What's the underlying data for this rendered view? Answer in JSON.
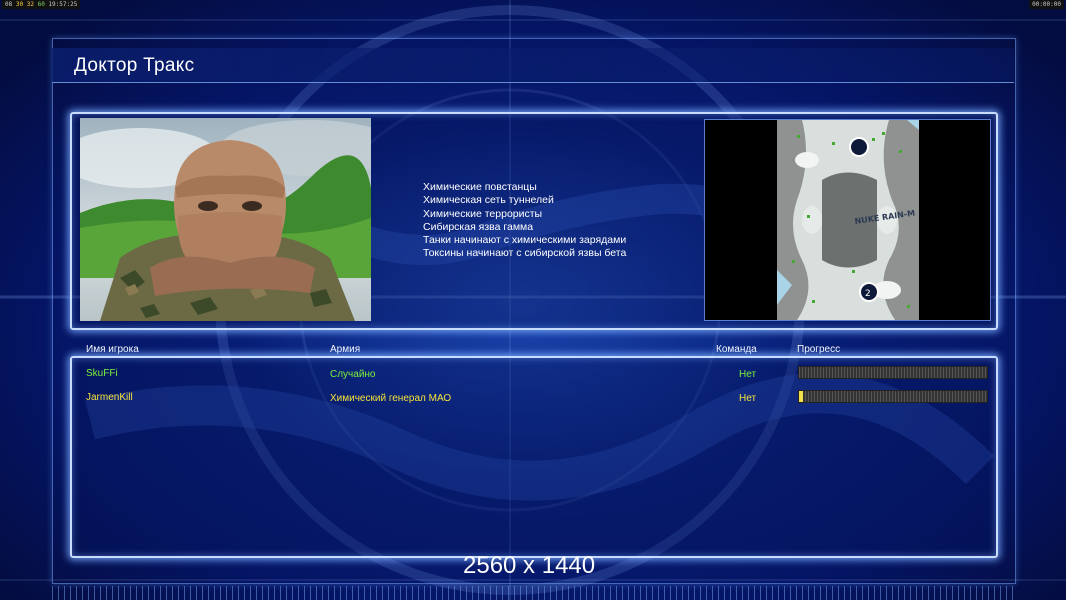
{
  "hud": {
    "left": [
      "08",
      "30",
      "32",
      "60",
      "19:57:25"
    ],
    "right": "00:00:00"
  },
  "general": {
    "name": "Доктор Тракс"
  },
  "info_lines": [
    "Химические повстанцы",
    "Химическая сеть туннелей",
    "Химические террористы",
    "Сибирская язва гамма",
    "Танки начинают с химическими зарядами",
    "Токсины начинают с сибирской язвы бета"
  ],
  "table": {
    "headers": {
      "player": "Имя игрока",
      "army": "Армия",
      "team": "Команда",
      "progress": "Прогресс"
    },
    "rows": [
      {
        "player": "SkuFFi",
        "army": "Случайно",
        "team": "Нет",
        "progress": 0.0,
        "color": "#7cf23a"
      },
      {
        "player": "JarmenKill",
        "army": "Химический генерал МАО",
        "team": "Нет",
        "progress": 0.02,
        "color": "#f5e23a"
      }
    ]
  },
  "minimap": {
    "markers": [
      "1",
      "2"
    ],
    "map_label": "NUKE RAIN-M"
  },
  "resolution": "2560 x 1440",
  "colors": {
    "panel_border": "#c8dcff",
    "background": "#061a5e"
  }
}
